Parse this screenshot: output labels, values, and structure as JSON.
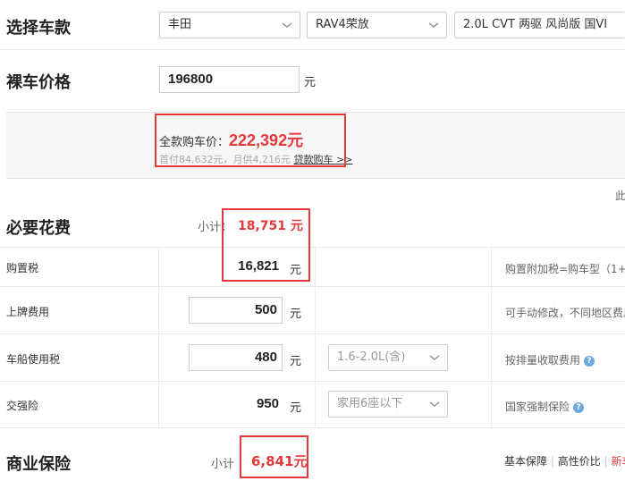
{
  "car_select": {
    "title": "选择车款",
    "brand": "丰田",
    "model": "RAV4荣放",
    "version": "2.0L CVT 两驱 风尚版 国VI"
  },
  "price": {
    "title": "裸车价格",
    "value": "196800",
    "unit": "元"
  },
  "summary": {
    "total_label": "全款购车价：",
    "total_value": "222,392元",
    "loan_text": "首付84,632元，月供4,216元",
    "loan_link": "贷款购车 >>",
    "right_hint": "此"
  },
  "required": {
    "title": "必要花费",
    "subtotal_label": "小计：",
    "subtotal_value": "18,751 元",
    "rows": [
      {
        "label": "购置税",
        "value": "16,821",
        "unit": "元",
        "note": "购置附加税=购车型（1+"
      },
      {
        "label": "上牌费用",
        "value": "500",
        "unit": "元",
        "note": "可手动修改，不同地区费用"
      },
      {
        "label": "车船使用税",
        "value": "480",
        "unit": "元",
        "select": "1.6-2.0L(含)",
        "note": "按排量收取费用"
      },
      {
        "label": "交强险",
        "value": "950",
        "unit": "元",
        "select": "家用6座以下",
        "note": "国家强制保险"
      }
    ]
  },
  "commercial": {
    "title": "商业保险",
    "subtotal_label": "小计",
    "subtotal_value": "6,841元",
    "options": [
      "基本保障",
      "高性价比",
      "新车"
    ]
  },
  "colors": {
    "accent": "#e4393c",
    "help": "#6fa7e0"
  },
  "icons": [
    "chevron-down-icon",
    "help-icon"
  ]
}
